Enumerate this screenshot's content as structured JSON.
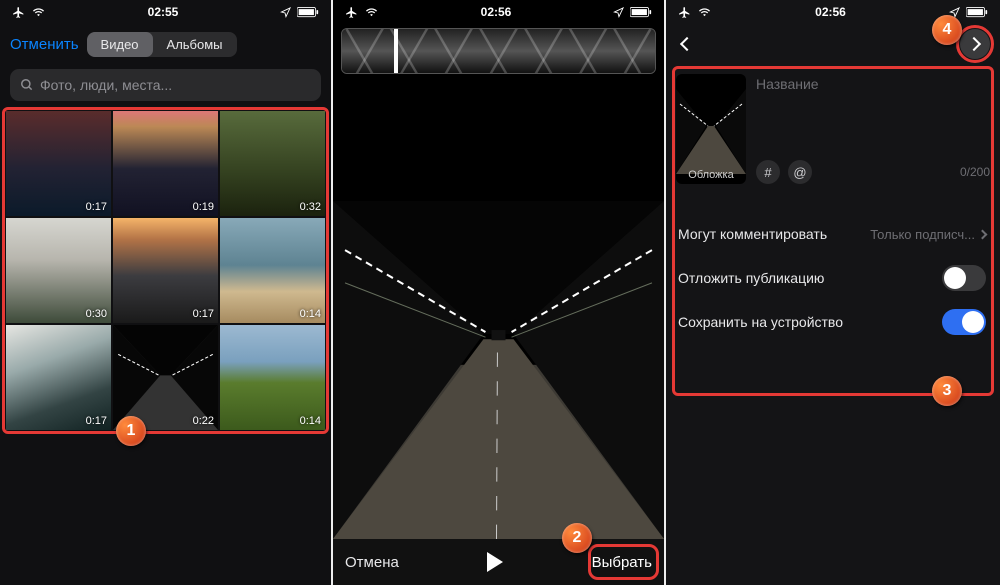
{
  "status": {
    "time1": "02:55",
    "time2": "02:56",
    "time3": "02:56"
  },
  "screen1": {
    "cancel": "Отменить",
    "tab_video": "Видео",
    "tab_albums": "Альбомы",
    "search_placeholder": "Фото, люди, места...",
    "thumbs": [
      {
        "duration": "0:17"
      },
      {
        "duration": "0:19"
      },
      {
        "duration": "0:32"
      },
      {
        "duration": "0:30"
      },
      {
        "duration": "0:17"
      },
      {
        "duration": "0:14"
      },
      {
        "duration": "0:17"
      },
      {
        "duration": "0:22"
      },
      {
        "duration": "0:14"
      }
    ],
    "badge": "1"
  },
  "screen2": {
    "cancel": "Отмена",
    "select": "Выбрать",
    "badge": "2"
  },
  "screen3": {
    "title_placeholder": "Название",
    "cover_label": "Обложка",
    "hash": "#",
    "at": "@",
    "char_counter": "0/200",
    "row_comment_label": "Могут комментировать",
    "row_comment_value": "Только подписч...",
    "row_schedule_label": "Отложить публикацию",
    "row_save_label": "Сохранить на устройство",
    "schedule_on": false,
    "save_on": true,
    "badge_box": "3",
    "badge_next": "4"
  }
}
